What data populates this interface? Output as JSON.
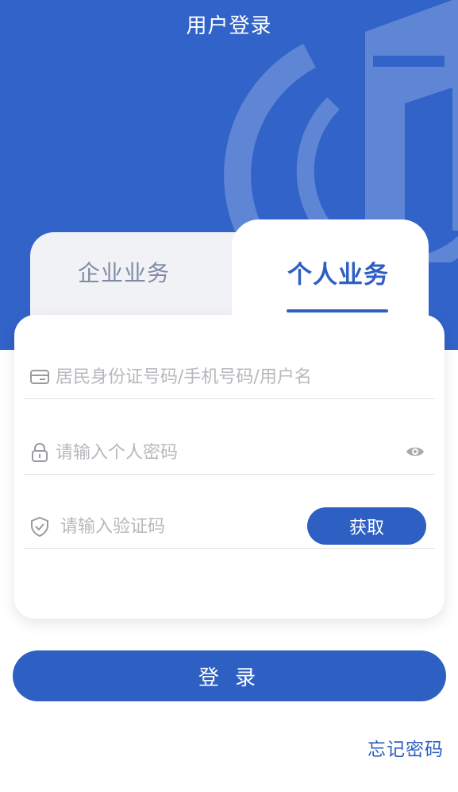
{
  "header": {
    "title": "用户登录"
  },
  "tabs": [
    {
      "label": "企业业务",
      "active": false
    },
    {
      "label": "个人业务",
      "active": true
    }
  ],
  "form": {
    "id_placeholder": "居民身份证号码/手机号码/用户名",
    "password_placeholder": "请输入个人密码",
    "captcha_placeholder": "请输入验证码",
    "get_code_label": "获取"
  },
  "actions": {
    "login_label": "登 录",
    "forgot_label": "忘记密码"
  },
  "icons": {
    "id": "id-card-icon",
    "password": "lock-icon",
    "captcha": "shield-check-icon",
    "toggle": "eye-icon"
  },
  "colors": {
    "brand_blue": "#2e5fc3",
    "header_blue": "#3263c9",
    "inactive_tab_text": "#7f8aa6",
    "placeholder": "#b7b8bd"
  }
}
